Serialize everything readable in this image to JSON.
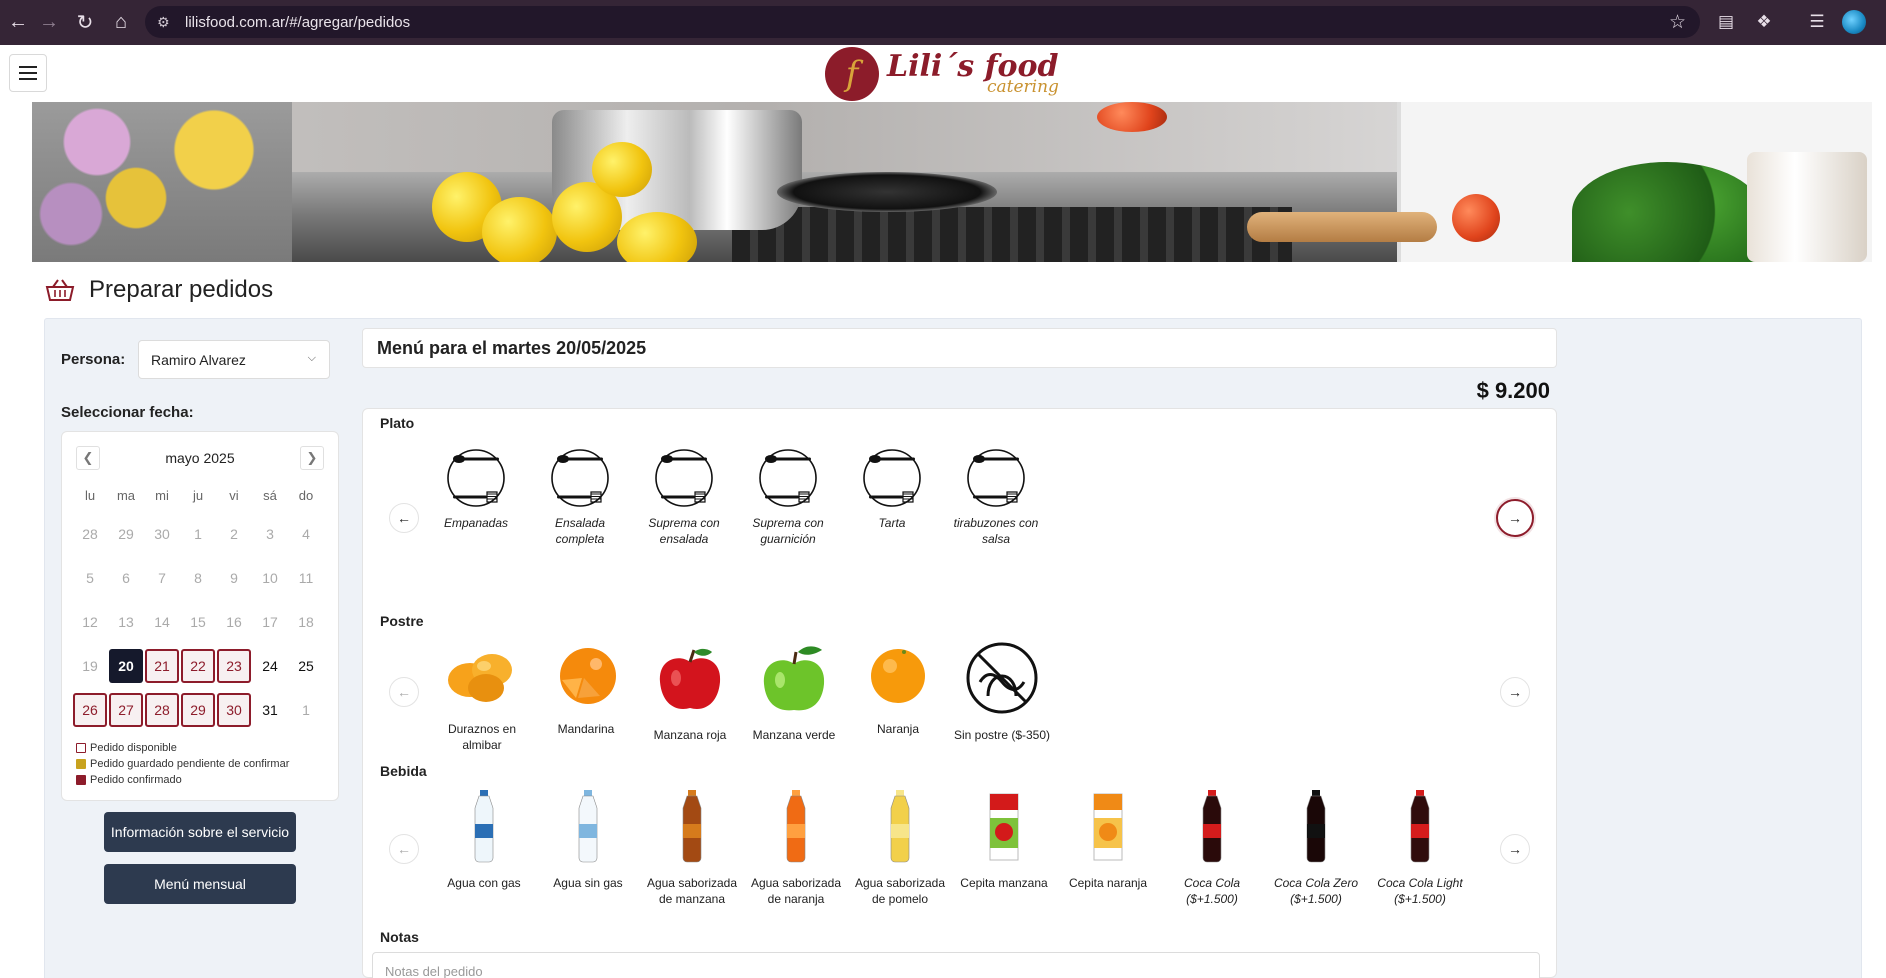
{
  "browser": {
    "url": "lilisfood.com.ar/#/agregar/pedidos"
  },
  "brand": {
    "name": "Lili´s food",
    "tagline": "catering",
    "mark": "f",
    "colors": {
      "primary": "#8c1c2a",
      "accent": "#c99230",
      "dark_button": "#2d3a4f"
    }
  },
  "page": {
    "title": "Preparar pedidos"
  },
  "persona": {
    "label": "Persona:",
    "value": "Ramiro Alvarez"
  },
  "calendar": {
    "label": "Seleccionar fecha:",
    "month": "mayo 2025",
    "dows": [
      "lu",
      "ma",
      "mi",
      "ju",
      "vi",
      "sá",
      "do"
    ],
    "weeks": [
      [
        {
          "d": "28",
          "t": "out"
        },
        {
          "d": "29",
          "t": "out"
        },
        {
          "d": "30",
          "t": "out"
        },
        {
          "d": "1",
          "t": "dis"
        },
        {
          "d": "2",
          "t": "dis"
        },
        {
          "d": "3",
          "t": "dis"
        },
        {
          "d": "4",
          "t": "dis"
        }
      ],
      [
        {
          "d": "5",
          "t": "dis"
        },
        {
          "d": "6",
          "t": "dis"
        },
        {
          "d": "7",
          "t": "dis"
        },
        {
          "d": "8",
          "t": "dis"
        },
        {
          "d": "9",
          "t": "dis"
        },
        {
          "d": "10",
          "t": "dis"
        },
        {
          "d": "11",
          "t": "dis"
        }
      ],
      [
        {
          "d": "12",
          "t": "dis"
        },
        {
          "d": "13",
          "t": "dis"
        },
        {
          "d": "14",
          "t": "dis"
        },
        {
          "d": "15",
          "t": "dis"
        },
        {
          "d": "16",
          "t": "dis"
        },
        {
          "d": "17",
          "t": "dis"
        },
        {
          "d": "18",
          "t": "dis"
        }
      ],
      [
        {
          "d": "19",
          "t": "dis"
        },
        {
          "d": "20",
          "t": "sel"
        },
        {
          "d": "21",
          "t": "avail"
        },
        {
          "d": "22",
          "t": "avail"
        },
        {
          "d": "23",
          "t": "avail"
        },
        {
          "d": "24",
          "t": "bold"
        },
        {
          "d": "25",
          "t": "bold"
        }
      ],
      [
        {
          "d": "26",
          "t": "avail"
        },
        {
          "d": "27",
          "t": "avail"
        },
        {
          "d": "28",
          "t": "avail"
        },
        {
          "d": "29",
          "t": "avail"
        },
        {
          "d": "30",
          "t": "avail"
        },
        {
          "d": "31",
          "t": "bold"
        },
        {
          "d": "1",
          "t": "out"
        }
      ]
    ],
    "legend": [
      {
        "label": "Pedido disponible",
        "color": "#ffffff",
        "border": "#8d1c2b"
      },
      {
        "label": "Pedido guardado pendiente de confirmar",
        "color": "#c8a21e",
        "border": "#c8a21e"
      },
      {
        "label": "Pedido confirmado",
        "color": "#8d1c2b",
        "border": "#8d1c2b"
      }
    ]
  },
  "buttons": {
    "info": "Información sobre el servicio",
    "monthly": "Menú mensual"
  },
  "menu": {
    "title": "Menú para el martes 20/05/2025",
    "price": "$ 9.200",
    "plato": {
      "label": "Plato",
      "items": [
        "Empanadas",
        "Ensalada completa",
        "Suprema con ensalada",
        "Suprema con guarnición",
        "Tarta",
        "tirabuzones con salsa"
      ]
    },
    "postre": {
      "label": "Postre",
      "items": [
        "Duraznos en almibar",
        "Mandarina",
        "Manzana roja",
        "Manzana verde",
        "Naranja",
        "Sin postre ($-350)"
      ]
    },
    "bebida": {
      "label": "Bebida",
      "items": [
        "Agua con gas",
        "Agua sin gas",
        "Agua saborizada de manzana",
        "Agua saborizada de naranja",
        "Agua saborizada de pomelo",
        "Cepita manzana",
        "Cepita naranja",
        "Coca Cola ($+1.500)",
        "Coca Cola Zero ($+1.500)",
        "Coca Cola Light ($+1.500)"
      ]
    },
    "notes": {
      "label": "Notas",
      "placeholder": "Notas del pedido"
    }
  }
}
